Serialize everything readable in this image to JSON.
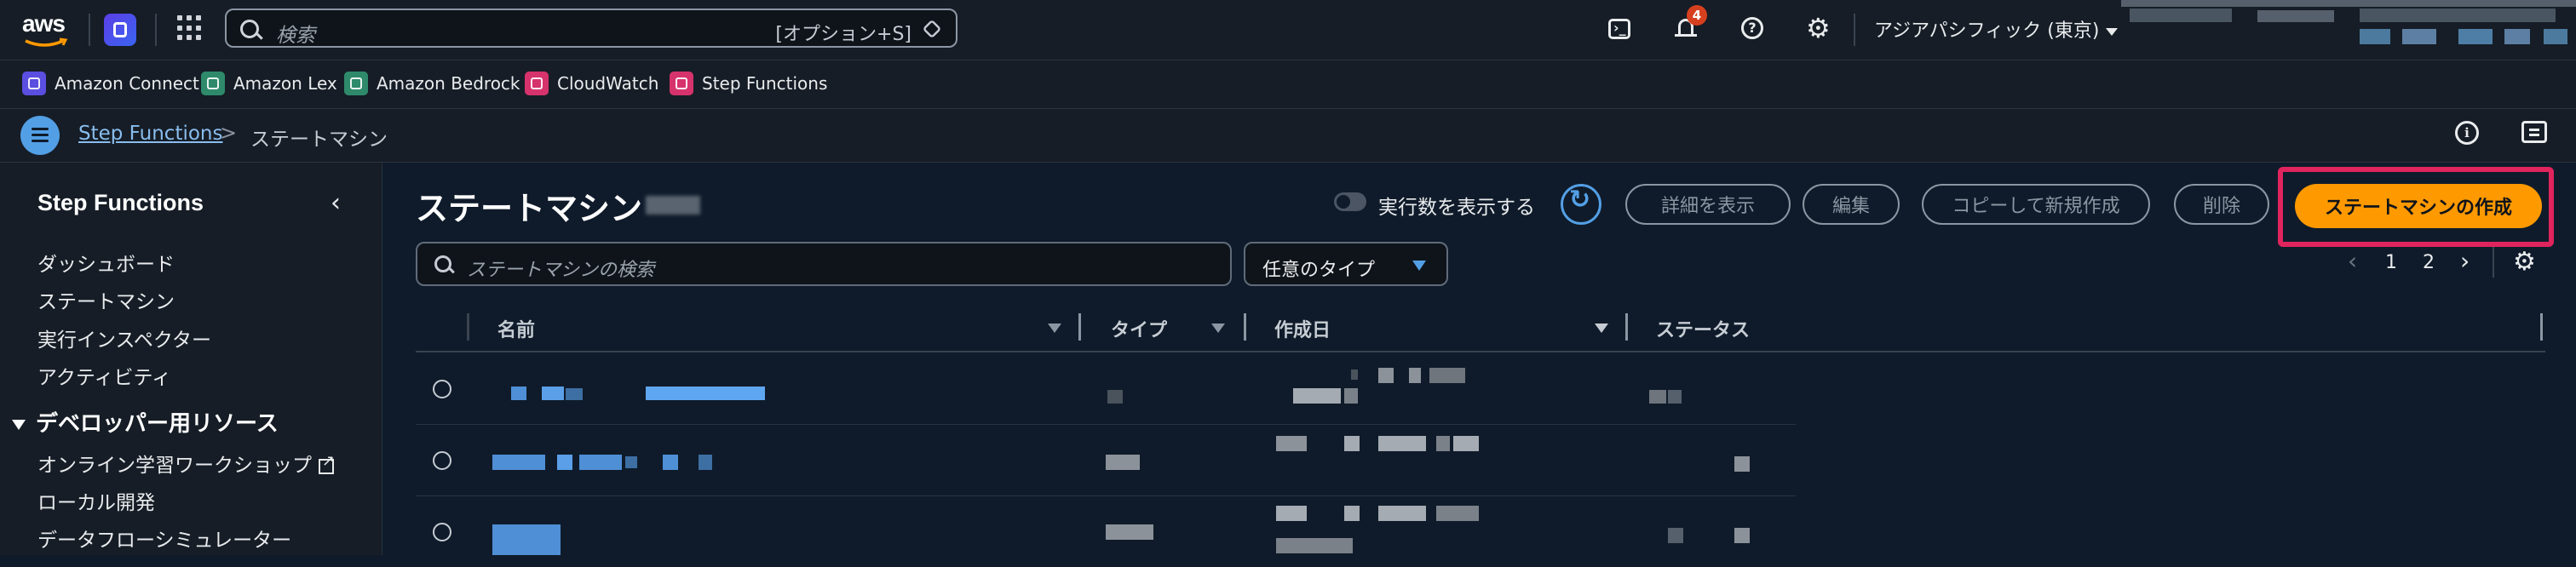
{
  "topnav": {
    "logo": "aws",
    "search_placeholder": "検索",
    "search_shortcut": "[オプション+S]",
    "notification_count": "4",
    "region": "アジアパシフィック (東京)"
  },
  "favorites": [
    {
      "label": "Amazon Connect",
      "color": "#5a4fe0"
    },
    {
      "label": "Amazon Lex",
      "color": "#2e8a6b"
    },
    {
      "label": "Amazon Bedrock",
      "color": "#2e8a6b"
    },
    {
      "label": "CloudWatch",
      "color": "#d6336c"
    },
    {
      "label": "Step Functions",
      "color": "#d6336c"
    }
  ],
  "breadcrumb": {
    "link": "Step Functions",
    "separator": ">",
    "current": "ステートマシン"
  },
  "sidebar": {
    "title": "Step Functions",
    "items": [
      {
        "label": "ダッシュボード"
      },
      {
        "label": "ステートマシン"
      },
      {
        "label": "実行インスペクター"
      },
      {
        "label": "アクティビティ"
      }
    ],
    "section": {
      "title": "デベロッパー用リソース",
      "items": [
        {
          "label": "オンライン学習ワークショップ"
        },
        {
          "label": "ローカル開発"
        },
        {
          "label": "データフローシミュレーター"
        }
      ]
    }
  },
  "main": {
    "title": "ステートマシン",
    "toggle_label": "実行数を表示する",
    "buttons": {
      "details": "詳細を表示",
      "edit": "編集",
      "copy_new": "コピーして新規作成",
      "delete": "削除",
      "create": "ステートマシンの作成"
    },
    "search_placeholder": "ステートマシンの検索",
    "type_filter": "任意のタイプ",
    "pagination": {
      "page1": "1",
      "page2": "2"
    },
    "table": {
      "columns": [
        {
          "label": "名前"
        },
        {
          "label": "タイプ"
        },
        {
          "label": "作成日"
        },
        {
          "label": "ステータス"
        }
      ]
    }
  },
  "colors": {
    "accent": "#539fe5",
    "primary_button": "#ff9900",
    "highlight": "#e0245e",
    "badge": "#d6401e"
  }
}
